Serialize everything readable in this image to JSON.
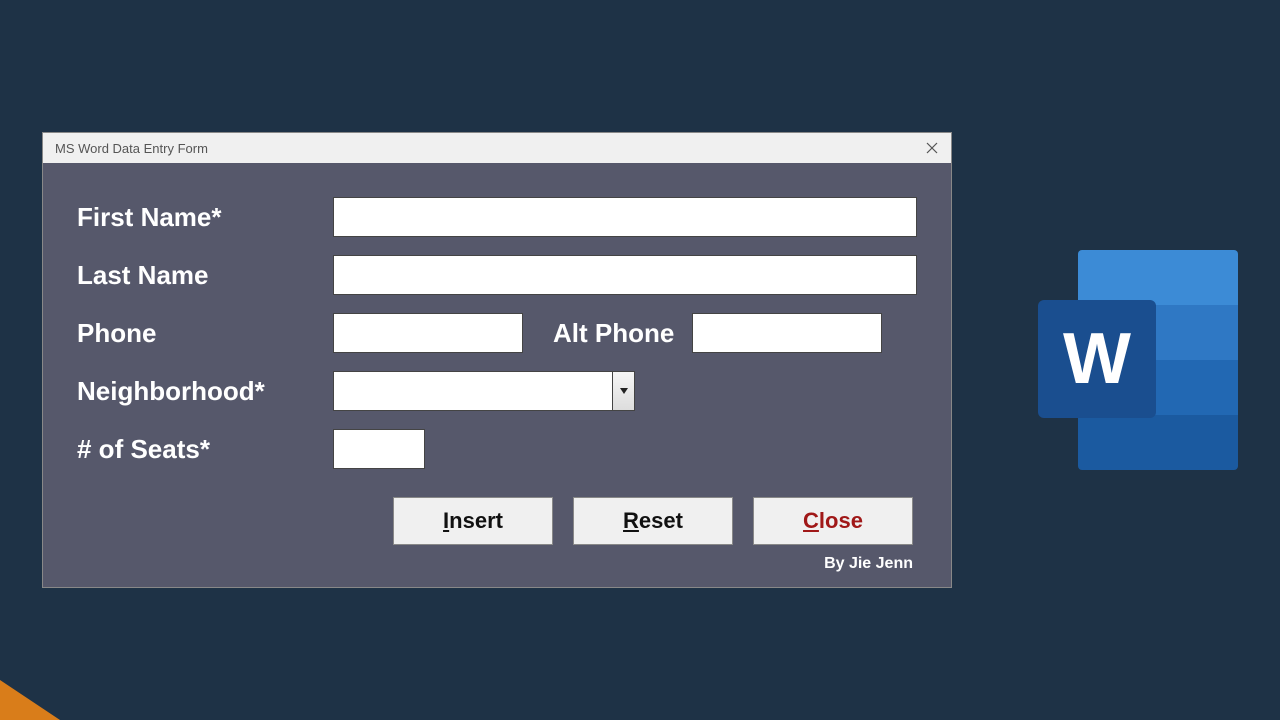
{
  "dialog": {
    "title": "MS Word Data Entry Form",
    "fields": {
      "first_name_label": "First Name*",
      "last_name_label": "Last Name",
      "phone_label": "Phone",
      "alt_phone_label": "Alt Phone",
      "neighborhood_label": "Neighborhood*",
      "seats_label": "# of Seats*"
    },
    "values": {
      "first_name": "",
      "last_name": "",
      "phone": "",
      "alt_phone": "",
      "neighborhood": "",
      "seats": ""
    },
    "buttons": {
      "insert": {
        "prefix": "I",
        "rest": "nsert"
      },
      "reset": {
        "prefix": "R",
        "rest": "eset"
      },
      "close": {
        "prefix": "C",
        "rest": "lose"
      }
    },
    "credit": "By Jie Jenn"
  },
  "logo": {
    "letter": "W"
  }
}
